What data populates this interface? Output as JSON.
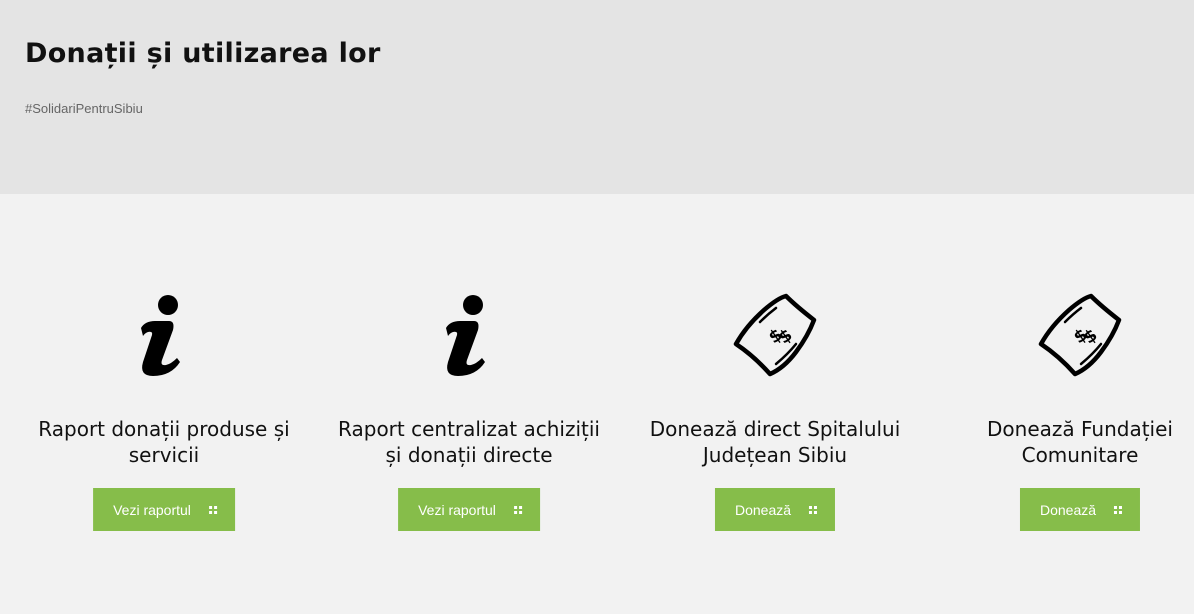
{
  "header": {
    "title": "Donații și utilizarea lor",
    "hashtag": "#SolidariPentruSibiu"
  },
  "cards": [
    {
      "icon": "info-icon",
      "title_line1": "Raport donații produse și",
      "title_line2": "servicii",
      "button_label": "Vezi raportul"
    },
    {
      "icon": "info-icon",
      "title_line1": "Raport centralizat achiziții",
      "title_line2": "și donații directe",
      "button_label": "Vezi raportul"
    },
    {
      "icon": "money-bill-icon",
      "title_line1": "Donează direct Spitalului",
      "title_line2": "Județean Sibiu",
      "button_label": "Donează"
    },
    {
      "icon": "money-bill-icon",
      "title_line1": "Donează Fundației",
      "title_line2": "Comunitare",
      "button_label": "Donează"
    }
  ],
  "colors": {
    "header_bg": "#e4e4e4",
    "page_bg": "#f2f2f2",
    "button_bg": "#86bd4a",
    "button_text": "#ffffff"
  }
}
